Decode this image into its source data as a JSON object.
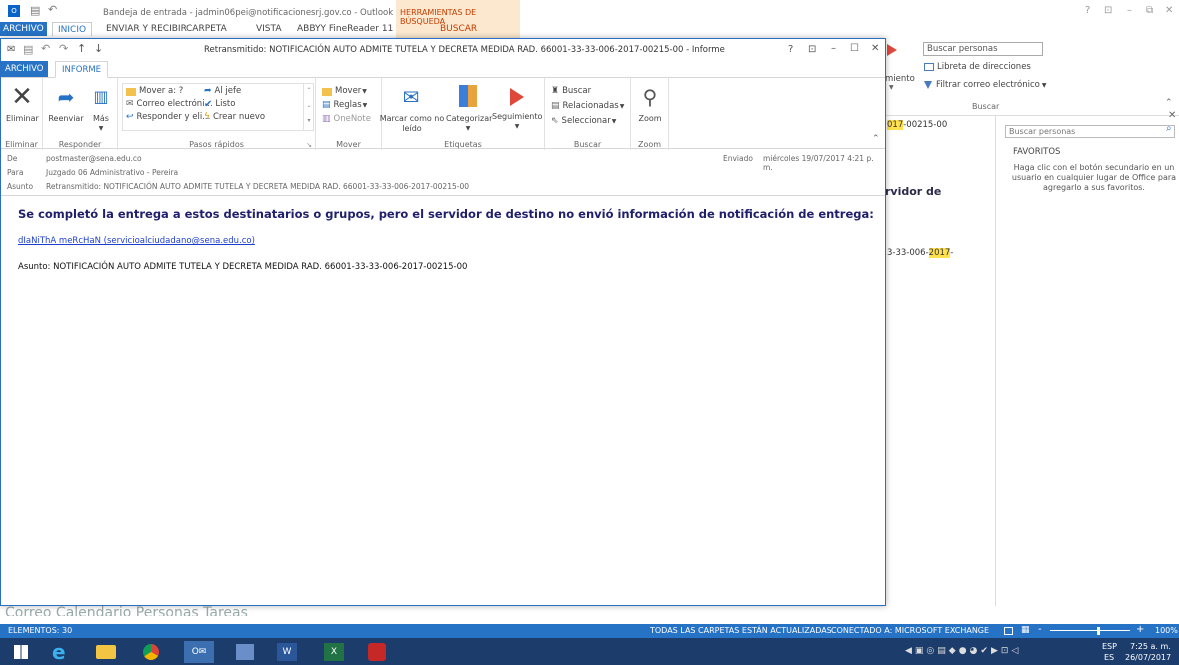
{
  "bg": {
    "title": "Bandeja de entrada - jadmin06pei@notificacionesrj.gov.co - Outlook",
    "tool_tab": "HERRAMIENTAS DE BÚSQUEDA",
    "tool_sub": "BUSCAR",
    "tabs": [
      "ARCHIVO",
      "INICIO",
      "ENVIAR Y RECIBIR",
      "CARPETA",
      "VISTA",
      "ABBYY FineReader 11"
    ],
    "window_controls": [
      "?",
      "⊡",
      "–",
      "⧉",
      "✕"
    ],
    "search_people": "Buscar personas",
    "address_book": "Libreta de direcciones",
    "filter_mail": "Filtrar correo electrónico",
    "search_group": "Buscar",
    "fragment_miento": "miento",
    "fragment_year1_a": "017",
    "fragment_year1_b": "-00215-00",
    "fragment_servidor": "rvidor de",
    "fragment_year2_a": "3-33-006-",
    "fragment_year2_b": "2017",
    "fragment_year2_c": "-",
    "right_search": "Buscar personas",
    "favorites_title": "FAVORITOS",
    "favorites_text": "Haga clic con el botón secundario en un usuario en cualquier lugar de Office para agregarlo a sus favoritos.",
    "nav_fade": "Correo   Calendario   Personas   Tareas"
  },
  "status": {
    "items": "ELEMENTOS: 30",
    "sync": "TODAS LAS CARPETAS ESTÁN ACTUALIZADAS.",
    "connected": "CONECTADO A: MICROSOFT EXCHANGE",
    "zoom": "100%"
  },
  "taskbar": {
    "lang1": "ESP",
    "lang2": "ES",
    "time": "7:25 a. m.",
    "date": "26/07/2017"
  },
  "win": {
    "title": "Retransmitido: NOTIFICACIÓN AUTO ADMITE  TUTELA Y DECRETA MEDIDA RAD. 66001-33-33-006-2017-00215-00  -  Informe",
    "controls": [
      "?",
      "⊡",
      "–",
      "☐",
      "✕"
    ],
    "tabs": [
      "ARCHIVO",
      "INFORME"
    ],
    "ribbon": {
      "eliminar": "Eliminar",
      "reenviar": "Reenviar",
      "mas": "Más",
      "g_eliminar": "Eliminar",
      "g_responder": "Responder",
      "qs": [
        "Mover a: ?",
        "Al jefe",
        "Correo electróni...",
        "Listo",
        "Responder y eli...",
        "Crear nuevo"
      ],
      "g_qs": "Pasos rápidos",
      "mover": "Mover",
      "reglas": "Reglas",
      "onenote": "OneNote",
      "g_mover": "Mover",
      "marcar": "Marcar como no leído",
      "categorizar": "Categorizar",
      "seguimiento": "Seguimiento",
      "g_etiquetas": "Etiquetas",
      "buscar": "Buscar",
      "relacionadas": "Relacionadas",
      "seleccionar": "Seleccionar",
      "g_buscar": "Buscar",
      "zoom": "Zoom",
      "g_zoom": "Zoom"
    },
    "header": {
      "de_label": "De",
      "de": "postmaster@sena.edu.co",
      "para_label": "Para",
      "para": "Juzgado 06 Administrativo - Pereira",
      "asunto_label": "Asunto",
      "asunto": "Retransmitido: NOTIFICACIÓN AUTO ADMITE  TUTELA Y DECRETA MEDIDA RAD. 66001-33-33-006-2017-00215-00",
      "enviado_label": "Enviado",
      "enviado": "miércoles 19/07/2017 4:21 p. m."
    },
    "body": {
      "heading": "Se completó la entrega a estos destinatarios o grupos, pero el servidor de destino no envió información de notificación de entrega:",
      "recipient": "dIaNiThA meRcHaN (servicioalciudadano@sena.edu.co)",
      "subject": "Asunto: NOTIFICACIÓN AUTO ADMITE TUTELA Y DECRETA MEDIDA RAD. 66001-33-33-006-2017-00215-00"
    }
  }
}
